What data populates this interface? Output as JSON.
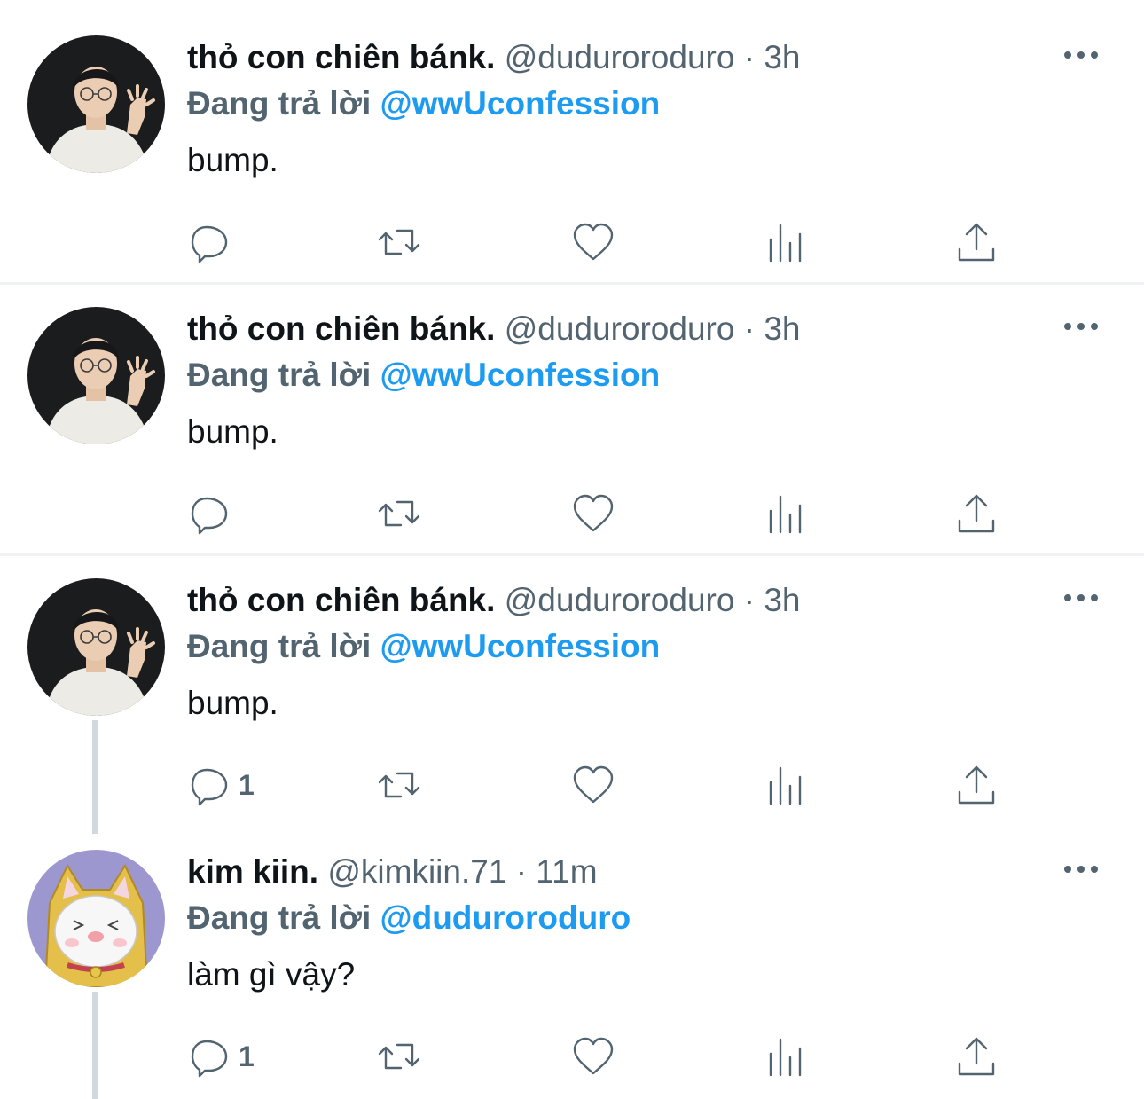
{
  "tweets": [
    {
      "name": "thỏ con chiên bánk.",
      "handle": "@duduroroduro",
      "dot": "·",
      "time": "3h",
      "replying_prefix": "Đang trả lời",
      "mention": "@wwUconfession",
      "text": "bump.",
      "reply_count": "",
      "avatar": "young man with glasses making claw gesture"
    },
    {
      "name": "thỏ con chiên bánk.",
      "handle": "@duduroroduro",
      "dot": "·",
      "time": "3h",
      "replying_prefix": "Đang trả lời",
      "mention": "@wwUconfession",
      "text": "bump.",
      "reply_count": "",
      "avatar": "young man with glasses making claw gesture"
    },
    {
      "name": "thỏ con chiên bánk.",
      "handle": "@duduroroduro",
      "dot": "·",
      "time": "3h",
      "replying_prefix": "Đang trả lời",
      "mention": "@wwUconfession",
      "text": "bump.",
      "reply_count": "1",
      "avatar": "young man with glasses making claw gesture"
    },
    {
      "name": "kim kiin.",
      "handle": "@kimkiin.71",
      "dot": "·",
      "time": "11m",
      "replying_prefix": "Đang trả lời",
      "mention": "@duduroroduro",
      "text": "làm gì vậy?",
      "reply_count": "1",
      "avatar": "white cartoon cat in yellow hood"
    }
  ],
  "icons": {
    "reply": "reply-icon",
    "retweet": "retweet-icon",
    "like": "heart-icon",
    "views": "views-icon",
    "share": "share-icon",
    "more": "more-icon"
  },
  "colors": {
    "accent": "#1d9bf0",
    "secondary_text": "#536471",
    "primary_text": "#0f1419",
    "divider": "#eff3f4",
    "thread_line": "#cfd9de"
  }
}
